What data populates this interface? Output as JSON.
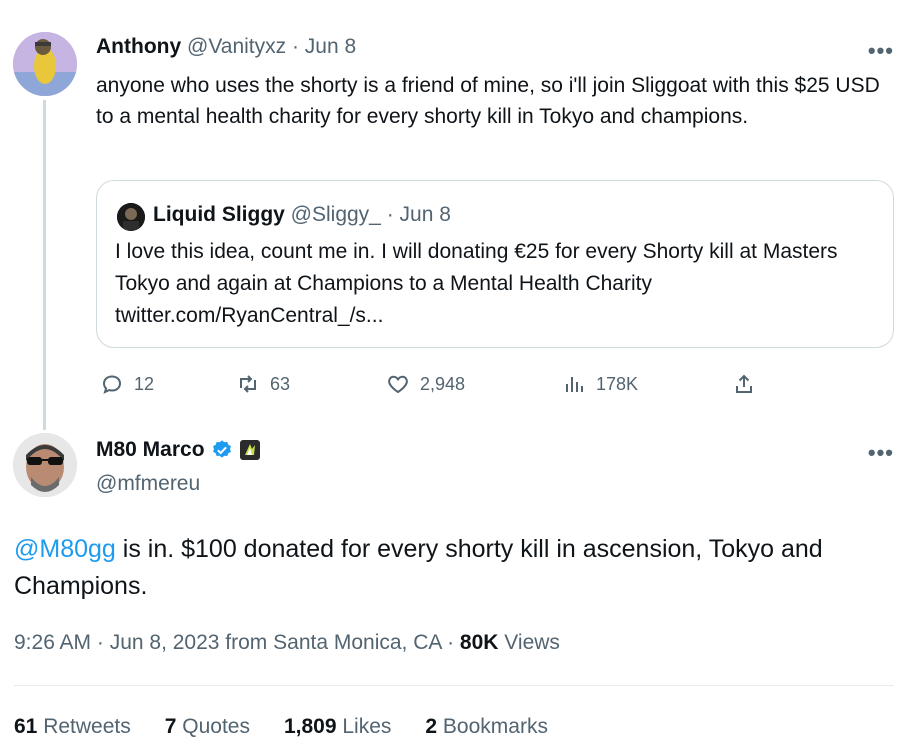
{
  "parent_tweet": {
    "name": "Anthony",
    "handle": "@Vanityxz",
    "date": "· Jun 8",
    "text": "anyone who uses the shorty is a friend of mine, so i'll join Sliggoat with this $25 USD to a mental health charity for every shorty kill in Tokyo and champions.",
    "more_icon": "more-icon",
    "quote": {
      "name": "Liquid Sliggy",
      "handle": "@Sliggy_",
      "date": "· Jun 8",
      "text": "I love this idea, count me in. I will donating €25 for every Shorty kill at Masters Tokyo and again at Champions to a Mental Health Charity twitter.com/RyanCentral_/s..."
    },
    "actions": {
      "replies": "12",
      "retweets": "63",
      "likes": "2,948",
      "views": "178K"
    }
  },
  "main_tweet": {
    "name": "M80 Marco",
    "handle": "@mfmereu",
    "mention": "@M80gg",
    "text": " is in. $100 donated for every shorty kill in ascension, Tokyo and Champions.",
    "timestamp": "9:26 AM · Jun 8, 2023 from Santa Monica, CA · ",
    "views_count": "80K",
    "views_label": " Views",
    "stats": {
      "retweets_count": "61",
      "retweets_label": " Retweets",
      "quotes_count": "7",
      "quotes_label": " Quotes",
      "likes_count": "1,809",
      "likes_label": " Likes",
      "bookmarks_count": "2",
      "bookmarks_label": " Bookmarks"
    }
  },
  "colors": {
    "accent": "#1d9bf0",
    "muted": "#536471",
    "verified": "#1d9bf0",
    "affiliate_badge": "#2b2b2b"
  }
}
